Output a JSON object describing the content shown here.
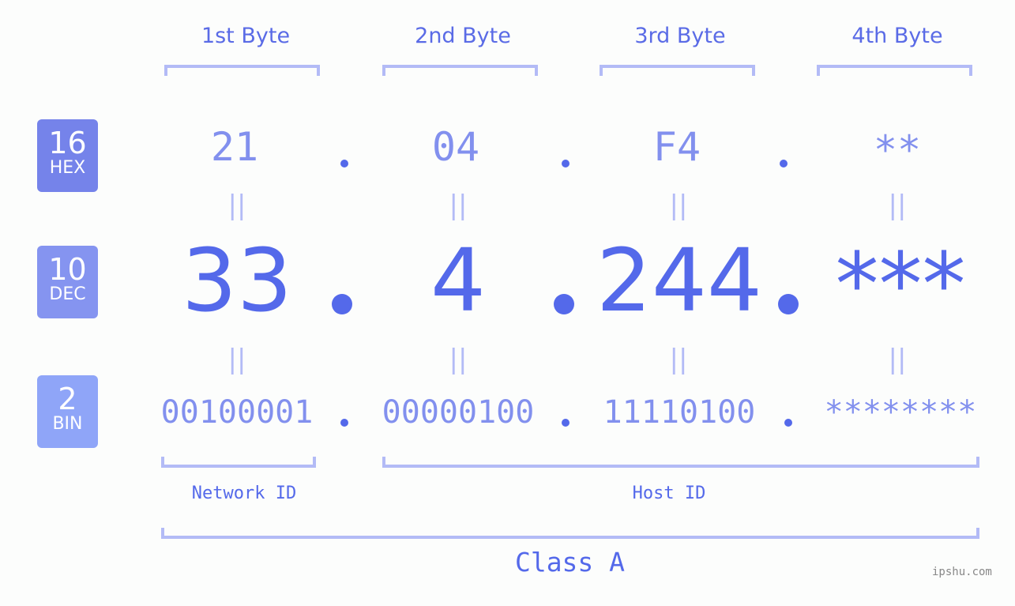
{
  "bytes": [
    {
      "header": "1st Byte",
      "hex": "21",
      "dec": "33",
      "bin": "00100001"
    },
    {
      "header": "2nd Byte",
      "hex": "04",
      "dec": "4",
      "bin": "00000100"
    },
    {
      "header": "3rd Byte",
      "hex": "F4",
      "dec": "244",
      "bin": "11110100"
    },
    {
      "header": "4th Byte",
      "hex": "**",
      "dec": "***",
      "bin": "********"
    }
  ],
  "badges": {
    "hex": {
      "number": "16",
      "label": "HEX",
      "color": "#7583ea"
    },
    "dec": {
      "number": "10",
      "label": "DEC",
      "color": "#8594f0"
    },
    "bin": {
      "number": "2",
      "label": "BIN",
      "color": "#8fa5f8"
    }
  },
  "equals_glyph": "||",
  "network_id_label": "Network ID",
  "host_id_label": "Host ID",
  "class_label": "Class A",
  "watermark": "ipshu.com",
  "colors": {
    "accent": "#5469ea",
    "light_value": "#8290ee",
    "bracket": "#b3bbf6"
  }
}
